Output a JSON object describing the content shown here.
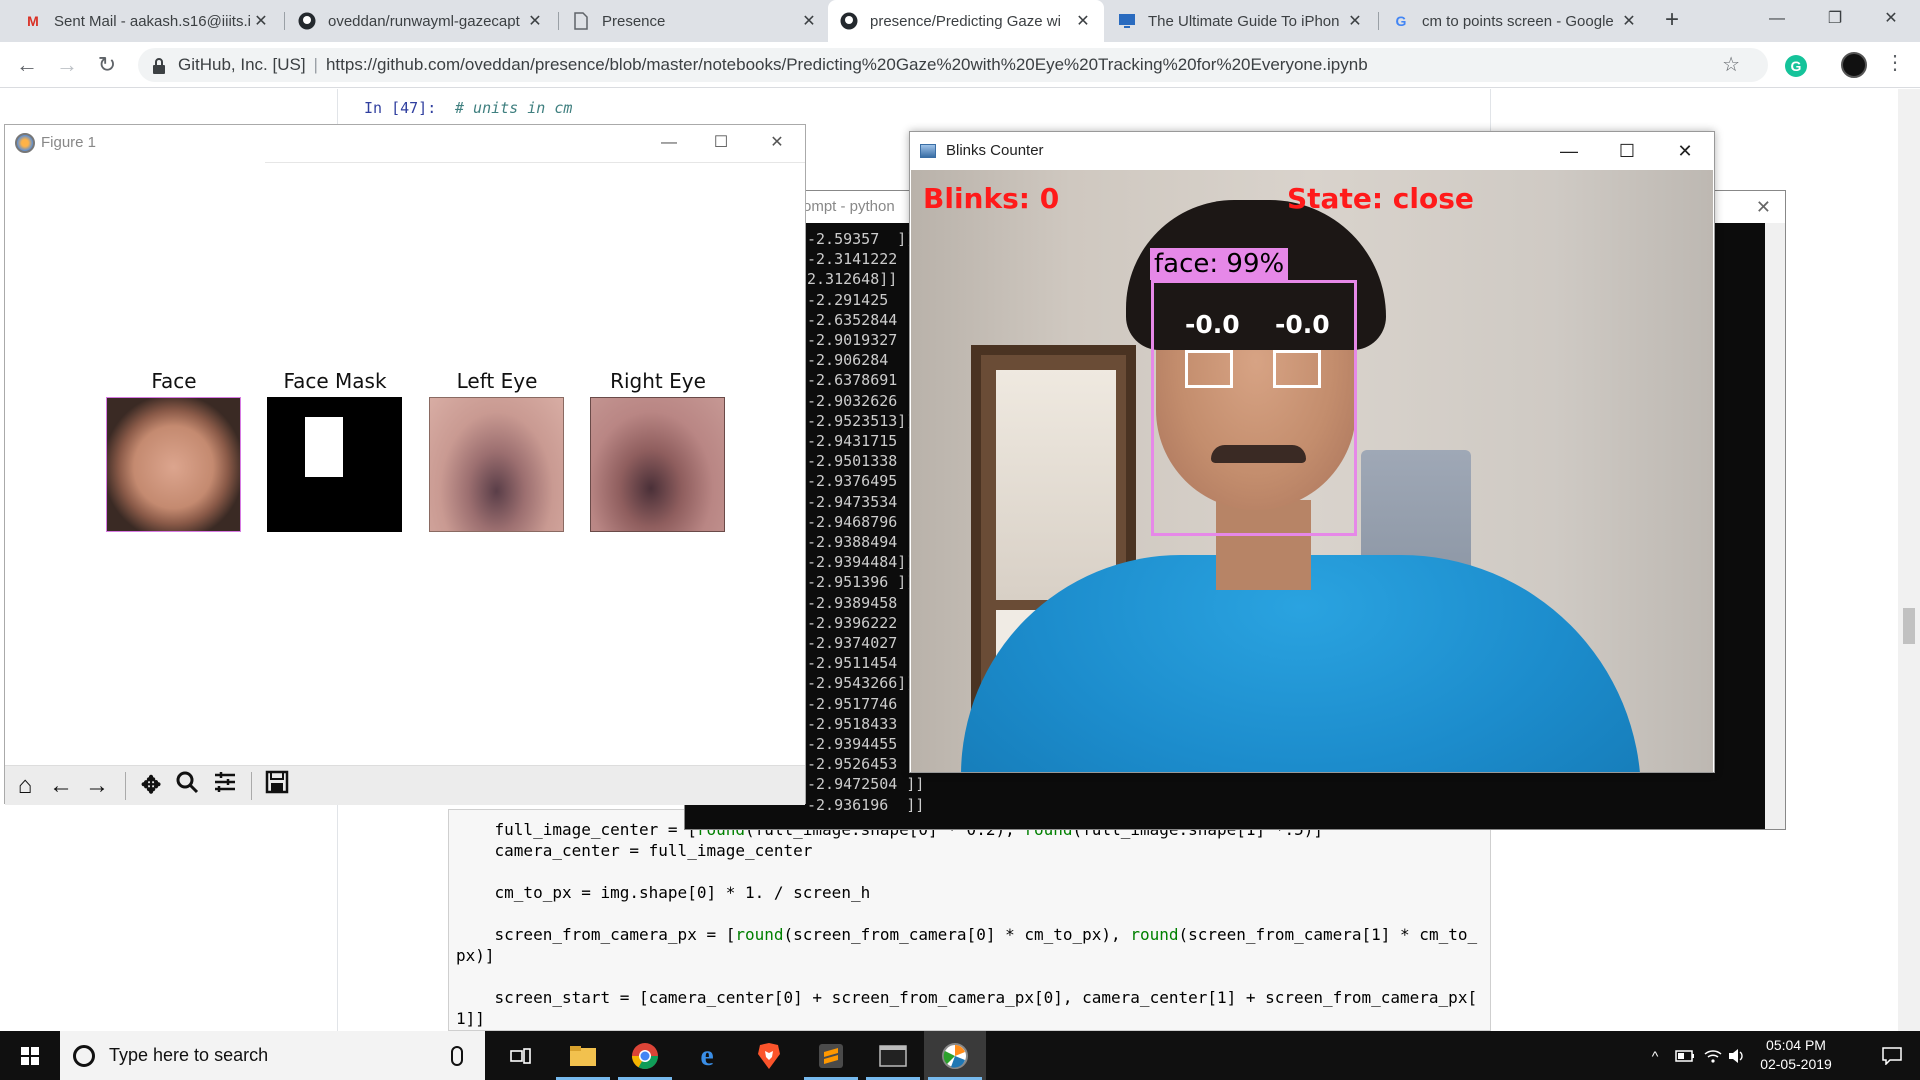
{
  "browser": {
    "tabs": [
      {
        "title": "Sent Mail - aakash.s16@iiits.i",
        "icon": "gmail-icon"
      },
      {
        "title": "oveddan/runwayml-gazecapt",
        "icon": "github-icon"
      },
      {
        "title": "Presence",
        "icon": "document-icon"
      },
      {
        "title": "presence/Predicting Gaze wi",
        "icon": "github-icon"
      },
      {
        "title": "The Ultimate Guide To iPhon",
        "icon": "monitor-icon"
      },
      {
        "title": "cm to points screen - Google",
        "icon": "google-icon"
      }
    ],
    "active_tab": 3,
    "new_tab": "+",
    "address": {
      "org": "GitHub, Inc. [US]",
      "separator": "|",
      "url": "https://github.com/oveddan/presence/blob/master/notebooks/Predicting%20Gaze%20with%20Eye%20Tracking%20for%20Everyone.ipynb"
    },
    "extension_letter": "G"
  },
  "notebook": {
    "prompt": "In [47]:",
    "comment": "# units in cm",
    "code_lines": [
      {
        "parts": [
          {
            "t": "    full_image_center = [",
            "c": ""
          },
          {
            "t": "round",
            "c": "fn"
          },
          {
            "t": "(full_image.shape[0] * 0.2), ",
            "c": ""
          },
          {
            "t": "round",
            "c": "fn"
          },
          {
            "t": "(full_image.shape[1] *.5)]",
            "c": ""
          }
        ]
      },
      {
        "parts": [
          {
            "t": "    camera_center = full_image_center",
            "c": ""
          }
        ]
      },
      {
        "parts": [
          {
            "t": "",
            "c": ""
          }
        ]
      },
      {
        "parts": [
          {
            "t": "    cm_to_px = img.shape[0] * 1. / screen_h",
            "c": ""
          }
        ]
      },
      {
        "parts": [
          {
            "t": "",
            "c": ""
          }
        ]
      },
      {
        "parts": [
          {
            "t": "    screen_from_camera_px = [",
            "c": ""
          },
          {
            "t": "round",
            "c": "fn"
          },
          {
            "t": "(screen_from_camera[0] * cm_to_px), ",
            "c": ""
          },
          {
            "t": "round",
            "c": "fn"
          },
          {
            "t": "(screen_from_camera[1] * cm_to_",
            "c": ""
          }
        ]
      },
      {
        "parts": [
          {
            "t": "px)]",
            "c": ""
          }
        ]
      },
      {
        "parts": [
          {
            "t": "",
            "c": ""
          }
        ]
      },
      {
        "parts": [
          {
            "t": "    screen_start = [camera_center[0] + screen_from_camera_px[0], camera_center[1] + screen_from_camera_px[",
            "c": ""
          }
        ]
      },
      {
        "parts": [
          {
            "t": "1]]",
            "c": ""
          }
        ]
      }
    ]
  },
  "cmd": {
    "title": "ompt - python",
    "lines": [
      "-2.59357  ]]",
      "-2.3141222",
      "2.312648]]",
      "-2.291425",
      "-2.6352844",
      "-2.9019327",
      "-2.906284",
      "-2.6378691",
      "-2.9032626",
      "-2.9523513]]",
      "-2.9431715",
      "-2.9501338",
      "-2.9376495",
      "-2.9473534",
      "-2.9468796",
      "-2.9388494",
      "-2.9394484]]",
      "-2.951396 ]]",
      "-2.9389458",
      "-2.9396222",
      "-2.9374027",
      "-2.9511454",
      "-2.9543266]]",
      "-2.9517746",
      "-2.9518433",
      "-2.9394455",
      "-2.9526453",
      "-2.9472504 ]]",
      "-2.936196  ]]"
    ]
  },
  "figure": {
    "title": "Figure 1",
    "panels": [
      {
        "label": "Face"
      },
      {
        "label": "Face Mask"
      },
      {
        "label": "Left Eye"
      },
      {
        "label": "Right Eye"
      }
    ],
    "toolbar": [
      "home-icon",
      "back-arrow-icon",
      "forward-arrow-icon",
      "pan-icon",
      "zoom-icon",
      "configure-subplots-icon",
      "save-icon"
    ]
  },
  "blinks": {
    "title": "Blinks Counter",
    "blinks_text": "Blinks: 0",
    "state_text": "State: close",
    "face_label": "face: 99%",
    "left_eye_value": "-0.0",
    "right_eye_value": "-0.0",
    "overlay_colors": {
      "text": "#ff1a1a",
      "face_box": "#e688e8",
      "eye_box": "#ffffff"
    }
  },
  "taskbar": {
    "search_placeholder": "Type here to search",
    "apps": [
      "task-view-icon",
      "file-explorer-icon",
      "chrome-icon",
      "edge-icon",
      "brave-icon",
      "sublime-text-icon",
      "terminal-icon",
      "matplotlib-icon"
    ],
    "time": "05:04 PM",
    "date": "02-05-2019"
  }
}
